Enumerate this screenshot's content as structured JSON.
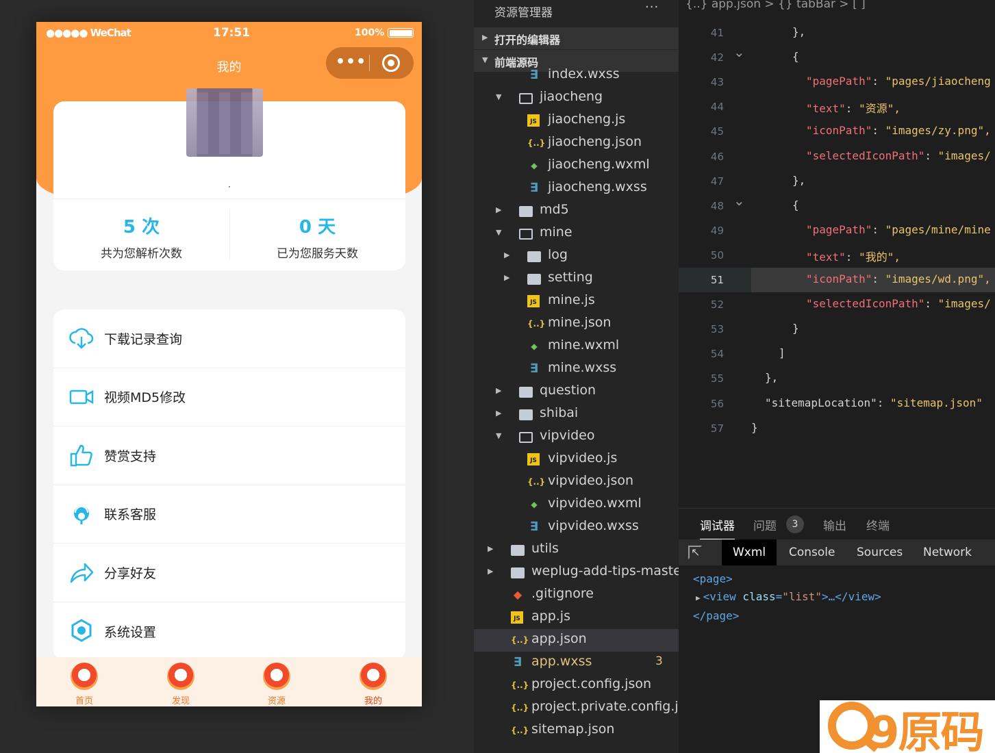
{
  "simulator": {
    "status_signal": "●●●●● WeChat",
    "status_time": "17:51",
    "status_battery": "100%",
    "nav_title": "我的",
    "capsule_more": "•••",
    "profile_name": "·",
    "stats": [
      {
        "value": "5 次",
        "label": "共为您解析次数"
      },
      {
        "value": "0 天",
        "label": "已为您服务天数"
      }
    ],
    "menu": [
      {
        "label": "下载记录查询",
        "icon": "cloud-download-icon"
      },
      {
        "label": "视频MD5修改",
        "icon": "video-camera-icon"
      },
      {
        "label": "赞赏支持",
        "icon": "thumbs-up-icon"
      },
      {
        "label": "联系客服",
        "icon": "customer-service-icon"
      },
      {
        "label": "分享好友",
        "icon": "share-arrow-icon"
      },
      {
        "label": "系统设置",
        "icon": "settings-gear-icon"
      }
    ],
    "tabs": [
      {
        "label": "首页",
        "icon": "home-icon"
      },
      {
        "label": "发现",
        "icon": "discover-icon"
      },
      {
        "label": "资源",
        "icon": "heart-icon"
      },
      {
        "label": "我的",
        "icon": "user-icon"
      }
    ],
    "colors": {
      "accent": "#fe9a40",
      "stat": "#26b6e8",
      "icon": "#26b6e8"
    }
  },
  "explorer": {
    "title": "资源管理器",
    "more": "···",
    "open_editors": "打开的编辑器",
    "project": "前端源码",
    "items": [
      {
        "label": "index.wxss",
        "icon": "wxss-icon",
        "depth": 3
      },
      {
        "label": "jiaocheng",
        "icon": "folder-open-icon",
        "depth": 2,
        "caret": "▼"
      },
      {
        "label": "jiaocheng.js",
        "icon": "js-file-icon",
        "depth": 3
      },
      {
        "label": "jiaocheng.json",
        "icon": "json-file-icon",
        "depth": 3
      },
      {
        "label": "jiaocheng.wxml",
        "icon": "wxml-file-icon",
        "depth": 3
      },
      {
        "label": "jiaocheng.wxss",
        "icon": "wxss-icon",
        "depth": 3
      },
      {
        "label": "md5",
        "icon": "folder-icon",
        "depth": 2,
        "caret": "▶"
      },
      {
        "label": "mine",
        "icon": "folder-open-icon",
        "depth": 2,
        "caret": "▼"
      },
      {
        "label": "log",
        "icon": "folder-icon",
        "depth": 3,
        "caret": "▶"
      },
      {
        "label": "setting",
        "icon": "folder-icon",
        "depth": 3,
        "caret": "▶"
      },
      {
        "label": "mine.js",
        "icon": "js-file-icon",
        "depth": 3
      },
      {
        "label": "mine.json",
        "icon": "json-file-icon",
        "depth": 3
      },
      {
        "label": "mine.wxml",
        "icon": "wxml-file-icon",
        "depth": 3
      },
      {
        "label": "mine.wxss",
        "icon": "wxss-icon",
        "depth": 3
      },
      {
        "label": "question",
        "icon": "folder-icon",
        "depth": 2,
        "caret": "▶"
      },
      {
        "label": "shibai",
        "icon": "folder-icon",
        "depth": 2,
        "caret": "▶"
      },
      {
        "label": "vipvideo",
        "icon": "folder-open-icon",
        "depth": 2,
        "caret": "▼"
      },
      {
        "label": "vipvideo.js",
        "icon": "js-file-icon",
        "depth": 3
      },
      {
        "label": "vipvideo.json",
        "icon": "json-file-icon",
        "depth": 3
      },
      {
        "label": "vipvideo.wxml",
        "icon": "wxml-file-icon",
        "depth": 3
      },
      {
        "label": "vipvideo.wxss",
        "icon": "wxss-icon",
        "depth": 3
      },
      {
        "label": "utils",
        "icon": "folder-icon",
        "depth": 1,
        "caret": "▶"
      },
      {
        "label": "weplug-add-tips-master",
        "icon": "folder-icon",
        "depth": 1,
        "caret": "▶"
      },
      {
        "label": ".gitignore",
        "icon": "git-icon",
        "depth": 1
      },
      {
        "label": "app.js",
        "icon": "js-file-icon",
        "depth": 1
      },
      {
        "label": "app.json",
        "icon": "json-file-icon",
        "depth": 1,
        "selected": true
      },
      {
        "label": "app.wxss",
        "icon": "wxss-icon",
        "depth": 1,
        "badge": "3",
        "modified": true
      },
      {
        "label": "project.config.json",
        "icon": "json-file-icon",
        "depth": 1
      },
      {
        "label": "project.private.config.js...",
        "icon": "json-file-icon",
        "depth": 1
      },
      {
        "label": "sitemap.json",
        "icon": "json-file-icon",
        "depth": 1
      }
    ]
  },
  "editor": {
    "breadcrumb": "{..} app.json > {} tabBar > [ ]",
    "current_line": "51",
    "lines": [
      {
        "n": "41",
        "text": "},"
      },
      {
        "n": "42",
        "text": "{"
      },
      {
        "n": "43",
        "key": "\"pagePath\"",
        "val": "\"pages/jiaocheng"
      },
      {
        "n": "44",
        "key": "\"text\"",
        "val": "\"资源\","
      },
      {
        "n": "45",
        "key": "\"iconPath\"",
        "val": "\"images/zy.png\","
      },
      {
        "n": "46",
        "key": "\"selectedIconPath\"",
        "val": "\"images/"
      },
      {
        "n": "47",
        "text": "},"
      },
      {
        "n": "48",
        "text": "{"
      },
      {
        "n": "49",
        "key": "\"pagePath\"",
        "val": "\"pages/mine/mine"
      },
      {
        "n": "50",
        "key": "\"text\"",
        "val": "\"我的\","
      },
      {
        "n": "51",
        "key": "\"iconPath\"",
        "val": "\"images/wd.png\","
      },
      {
        "n": "52",
        "key": "\"selectedIconPath\"",
        "val": "\"images/"
      },
      {
        "n": "53",
        "text": "}"
      },
      {
        "n": "54",
        "text": "]"
      },
      {
        "n": "55",
        "text": "},"
      },
      {
        "n": "56",
        "key": "\"sitemapLocation\"",
        "val": "\"sitemap.json\""
      },
      {
        "n": "57",
        "text": "}"
      }
    ]
  },
  "debugger": {
    "tabs": [
      "调试器",
      "问题",
      "输出",
      "终端"
    ],
    "problems_count": "3",
    "panel_tabs": [
      "Wxml",
      "Console",
      "Sources",
      "Network"
    ],
    "tree": {
      "open": "<page>",
      "child_tag_open": "<view ",
      "attr": "class",
      "attr_val": "\"list\"",
      "child_rest": ">…</view>",
      "close": "</page>"
    }
  },
  "watermark": {
    "text": "9原码"
  }
}
